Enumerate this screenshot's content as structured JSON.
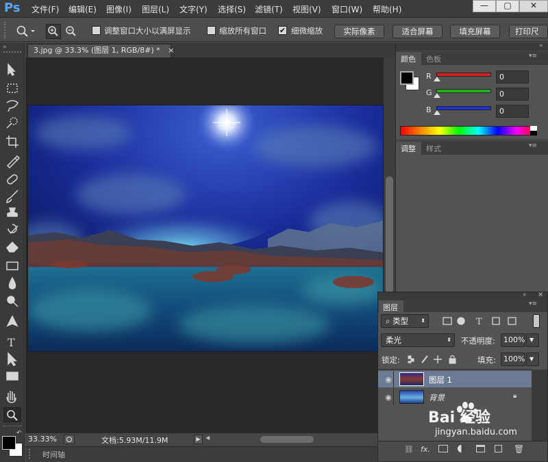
{
  "app": {
    "logo": "Ps",
    "menus": [
      "文件(F)",
      "编辑(E)",
      "图像(I)",
      "图层(L)",
      "文字(Y)",
      "选择(S)",
      "滤镜(T)",
      "视图(V)",
      "窗口(W)",
      "帮助(H)"
    ],
    "window_controls": [
      "—",
      "▢",
      "✕"
    ]
  },
  "options": {
    "resize_windows_label": "调整窗口大小以满屏显示",
    "zoom_all_label": "缩放所有窗口",
    "scrubby_zoom_label": "细微缩放",
    "scrubby_zoom_checked": true,
    "actual_pixels": "实际像素",
    "fit_screen": "适合屏幕",
    "fill_screen": "填充屏幕",
    "print_size": "打印尺"
  },
  "document": {
    "tab_title": "3.jpg @ 33.3% (图层 1, RGB/8#) *",
    "tab_close": "×",
    "zoom": "33.33%",
    "doc_info": "文档:5.93M/11.9M"
  },
  "timeline_label": "时间轴",
  "color_panel": {
    "tabs": [
      "颜色",
      "色板"
    ],
    "channels": [
      {
        "label": "R",
        "value": "0",
        "color": "#d42020"
      },
      {
        "label": "G",
        "value": "0",
        "color": "#20b020"
      },
      {
        "label": "B",
        "value": "0",
        "color": "#2030d0"
      }
    ]
  },
  "adjust_panel": {
    "tabs": [
      "调整",
      "样式"
    ]
  },
  "layers_panel": {
    "title": "图层",
    "filter_kind": "类型",
    "blend_mode": "柔光",
    "opacity_label": "不透明度:",
    "opacity_value": "100%",
    "lock_label": "锁定:",
    "fill_label": "填充:",
    "fill_value": "100%",
    "layers": [
      {
        "name": "图层 1",
        "selected": true,
        "locked": false
      },
      {
        "name": "背景",
        "selected": false,
        "locked": true
      }
    ],
    "bottom_fx": "fx."
  },
  "watermark": {
    "brand": "Bai 经验",
    "url": "jingyan.baidu.com"
  }
}
